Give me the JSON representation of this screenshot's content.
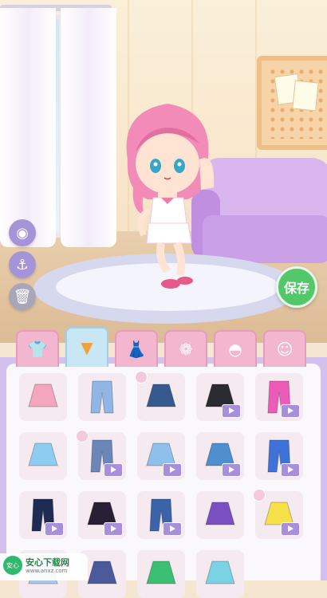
{
  "scene": {
    "side_buttons": [
      {
        "icon": "camera-icon"
      },
      {
        "icon": "anchor-icon"
      },
      {
        "icon": "trash-icon"
      }
    ],
    "save_label": "保存"
  },
  "tabs": [
    {
      "icon": "tshirt-icon",
      "active": false
    },
    {
      "icon": "skirt-icon",
      "active": true
    },
    {
      "icon": "dress-icon",
      "active": false
    },
    {
      "icon": "wings-icon",
      "active": false
    },
    {
      "icon": "hair-icon",
      "active": false
    },
    {
      "icon": "face-icon",
      "active": false
    }
  ],
  "items": [
    {
      "type": "pink plaid skirt",
      "color": "#f4a6bf",
      "video": false,
      "new": false
    },
    {
      "type": "ripped jeans",
      "color": "#8fb6e4",
      "video": false,
      "new": false
    },
    {
      "type": "navy denim skirt",
      "color": "#365a8e",
      "video": false,
      "new": true
    },
    {
      "type": "black skull skirt",
      "color": "#2b2b32",
      "video": true,
      "new": false
    },
    {
      "type": "magenta star pants",
      "color": "#ec5bb8",
      "video": true,
      "new": false
    },
    {
      "type": "light blue shorts",
      "color": "#8ecdf0",
      "video": false,
      "new": false
    },
    {
      "type": "patched jeans",
      "color": "#6b86b8",
      "video": true,
      "new": true
    },
    {
      "type": "blue ruffle skirt",
      "color": "#8fc0ec",
      "video": true,
      "new": false
    },
    {
      "type": "star denim skirt",
      "color": "#4f8fd0",
      "video": true,
      "new": false
    },
    {
      "type": "heart pants",
      "color": "#3f72d6",
      "video": true,
      "new": false
    },
    {
      "type": "graffiti pants",
      "color": "#1f2b55",
      "video": true,
      "new": false
    },
    {
      "type": "black star skirt",
      "color": "#2a2036",
      "video": true,
      "new": false
    },
    {
      "type": "flare jeans",
      "color": "#3a63a8",
      "video": true,
      "new": false
    },
    {
      "type": "purple chain skirt",
      "color": "#7a4fc2",
      "video": false,
      "new": false
    },
    {
      "type": "yellow ruffle skirt",
      "color": "#f6e04a",
      "video": true,
      "new": true
    },
    {
      "type": "item",
      "color": "#a9c9ec",
      "video": false,
      "new": false
    },
    {
      "type": "item",
      "color": "#4b5a9a",
      "video": false,
      "new": false
    },
    {
      "type": "item",
      "color": "#3bbf72",
      "video": false,
      "new": false
    },
    {
      "type": "item",
      "color": "#7ad3e4",
      "video": false,
      "new": false
    }
  ],
  "watermark": {
    "main": "安心下载网",
    "sub": "www.anxz.com"
  }
}
